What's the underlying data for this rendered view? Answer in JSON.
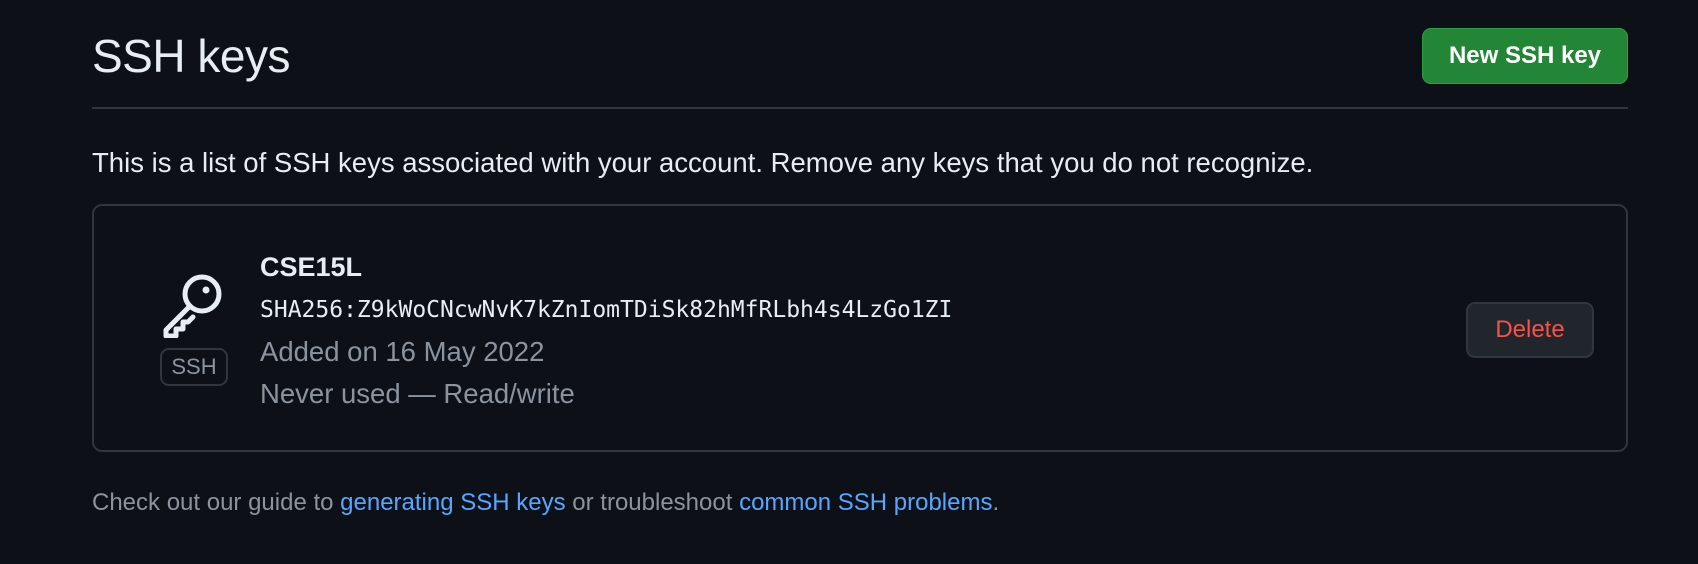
{
  "header": {
    "title": "SSH keys",
    "new_key_label": "New SSH key"
  },
  "intro": "This is a list of SSH keys associated with your account. Remove any keys that you do not recognize.",
  "keys": [
    {
      "icon": "key-icon",
      "type_label": "SSH",
      "title": "CSE15L",
      "fingerprint": "SHA256:Z9kWoCNcwNvK7kZnIomTDiSk82hMfRLbh4s4LzGo1ZI",
      "added": "Added on 16 May 2022",
      "usage": "Never used — Read/write",
      "delete_label": "Delete"
    }
  ],
  "footer": {
    "prefix": "Check out our guide to ",
    "link1": "generating SSH keys",
    "middle": " or troubleshoot ",
    "link2": "common SSH problems",
    "suffix": "."
  },
  "colors": {
    "background": "#0d1117",
    "primary_button": "#238636",
    "danger_text": "#f85149",
    "link": "#58a6ff",
    "muted_text": "#8b949e",
    "border": "#30363d"
  }
}
